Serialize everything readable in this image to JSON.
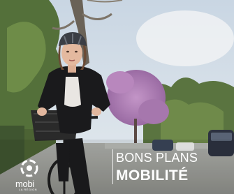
{
  "overlay": {
    "title_line_1": "BONS PLANS",
    "title_line_2": "MOBILITÉ"
  },
  "logo": {
    "wordmark": "mobi",
    "tagline": "LA RÉGION",
    "icon": "bicycle-wheel-logo-icon"
  },
  "scene": {
    "subject": "woman riding a bicycle with a front basket, wearing a bike helmet",
    "colors": {
      "sky": "#cfdbe6",
      "trees": "#5f7a3e",
      "blossom": "#b07fb6",
      "road": "#9a9a96",
      "text": "#ffffff"
    }
  }
}
